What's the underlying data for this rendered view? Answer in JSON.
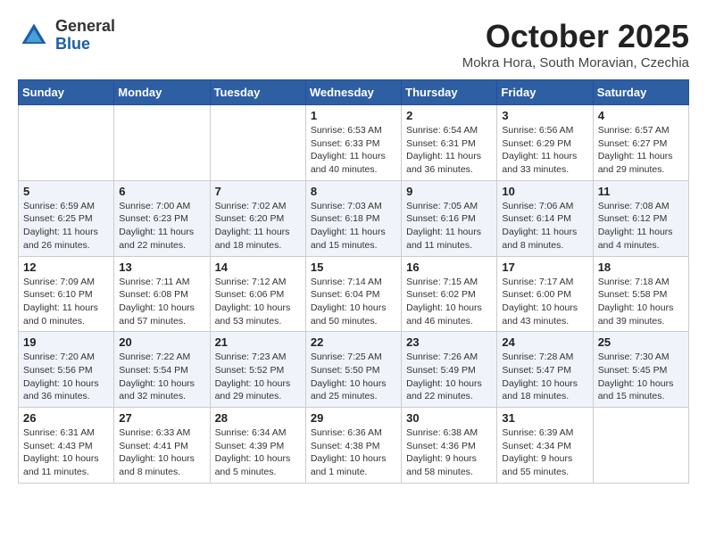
{
  "header": {
    "logo_line1": "General",
    "logo_line2": "Blue",
    "month": "October 2025",
    "location": "Mokra Hora, South Moravian, Czechia"
  },
  "weekdays": [
    "Sunday",
    "Monday",
    "Tuesday",
    "Wednesday",
    "Thursday",
    "Friday",
    "Saturday"
  ],
  "weeks": [
    [
      {
        "day": "",
        "info": ""
      },
      {
        "day": "",
        "info": ""
      },
      {
        "day": "",
        "info": ""
      },
      {
        "day": "1",
        "info": "Sunrise: 6:53 AM\nSunset: 6:33 PM\nDaylight: 11 hours\nand 40 minutes."
      },
      {
        "day": "2",
        "info": "Sunrise: 6:54 AM\nSunset: 6:31 PM\nDaylight: 11 hours\nand 36 minutes."
      },
      {
        "day": "3",
        "info": "Sunrise: 6:56 AM\nSunset: 6:29 PM\nDaylight: 11 hours\nand 33 minutes."
      },
      {
        "day": "4",
        "info": "Sunrise: 6:57 AM\nSunset: 6:27 PM\nDaylight: 11 hours\nand 29 minutes."
      }
    ],
    [
      {
        "day": "5",
        "info": "Sunrise: 6:59 AM\nSunset: 6:25 PM\nDaylight: 11 hours\nand 26 minutes."
      },
      {
        "day": "6",
        "info": "Sunrise: 7:00 AM\nSunset: 6:23 PM\nDaylight: 11 hours\nand 22 minutes."
      },
      {
        "day": "7",
        "info": "Sunrise: 7:02 AM\nSunset: 6:20 PM\nDaylight: 11 hours\nand 18 minutes."
      },
      {
        "day": "8",
        "info": "Sunrise: 7:03 AM\nSunset: 6:18 PM\nDaylight: 11 hours\nand 15 minutes."
      },
      {
        "day": "9",
        "info": "Sunrise: 7:05 AM\nSunset: 6:16 PM\nDaylight: 11 hours\nand 11 minutes."
      },
      {
        "day": "10",
        "info": "Sunrise: 7:06 AM\nSunset: 6:14 PM\nDaylight: 11 hours\nand 8 minutes."
      },
      {
        "day": "11",
        "info": "Sunrise: 7:08 AM\nSunset: 6:12 PM\nDaylight: 11 hours\nand 4 minutes."
      }
    ],
    [
      {
        "day": "12",
        "info": "Sunrise: 7:09 AM\nSunset: 6:10 PM\nDaylight: 11 hours\nand 0 minutes."
      },
      {
        "day": "13",
        "info": "Sunrise: 7:11 AM\nSunset: 6:08 PM\nDaylight: 10 hours\nand 57 minutes."
      },
      {
        "day": "14",
        "info": "Sunrise: 7:12 AM\nSunset: 6:06 PM\nDaylight: 10 hours\nand 53 minutes."
      },
      {
        "day": "15",
        "info": "Sunrise: 7:14 AM\nSunset: 6:04 PM\nDaylight: 10 hours\nand 50 minutes."
      },
      {
        "day": "16",
        "info": "Sunrise: 7:15 AM\nSunset: 6:02 PM\nDaylight: 10 hours\nand 46 minutes."
      },
      {
        "day": "17",
        "info": "Sunrise: 7:17 AM\nSunset: 6:00 PM\nDaylight: 10 hours\nand 43 minutes."
      },
      {
        "day": "18",
        "info": "Sunrise: 7:18 AM\nSunset: 5:58 PM\nDaylight: 10 hours\nand 39 minutes."
      }
    ],
    [
      {
        "day": "19",
        "info": "Sunrise: 7:20 AM\nSunset: 5:56 PM\nDaylight: 10 hours\nand 36 minutes."
      },
      {
        "day": "20",
        "info": "Sunrise: 7:22 AM\nSunset: 5:54 PM\nDaylight: 10 hours\nand 32 minutes."
      },
      {
        "day": "21",
        "info": "Sunrise: 7:23 AM\nSunset: 5:52 PM\nDaylight: 10 hours\nand 29 minutes."
      },
      {
        "day": "22",
        "info": "Sunrise: 7:25 AM\nSunset: 5:50 PM\nDaylight: 10 hours\nand 25 minutes."
      },
      {
        "day": "23",
        "info": "Sunrise: 7:26 AM\nSunset: 5:49 PM\nDaylight: 10 hours\nand 22 minutes."
      },
      {
        "day": "24",
        "info": "Sunrise: 7:28 AM\nSunset: 5:47 PM\nDaylight: 10 hours\nand 18 minutes."
      },
      {
        "day": "25",
        "info": "Sunrise: 7:30 AM\nSunset: 5:45 PM\nDaylight: 10 hours\nand 15 minutes."
      }
    ],
    [
      {
        "day": "26",
        "info": "Sunrise: 6:31 AM\nSunset: 4:43 PM\nDaylight: 10 hours\nand 11 minutes."
      },
      {
        "day": "27",
        "info": "Sunrise: 6:33 AM\nSunset: 4:41 PM\nDaylight: 10 hours\nand 8 minutes."
      },
      {
        "day": "28",
        "info": "Sunrise: 6:34 AM\nSunset: 4:39 PM\nDaylight: 10 hours\nand 5 minutes."
      },
      {
        "day": "29",
        "info": "Sunrise: 6:36 AM\nSunset: 4:38 PM\nDaylight: 10 hours\nand 1 minute."
      },
      {
        "day": "30",
        "info": "Sunrise: 6:38 AM\nSunset: 4:36 PM\nDaylight: 9 hours\nand 58 minutes."
      },
      {
        "day": "31",
        "info": "Sunrise: 6:39 AM\nSunset: 4:34 PM\nDaylight: 9 hours\nand 55 minutes."
      },
      {
        "day": "",
        "info": ""
      }
    ]
  ]
}
